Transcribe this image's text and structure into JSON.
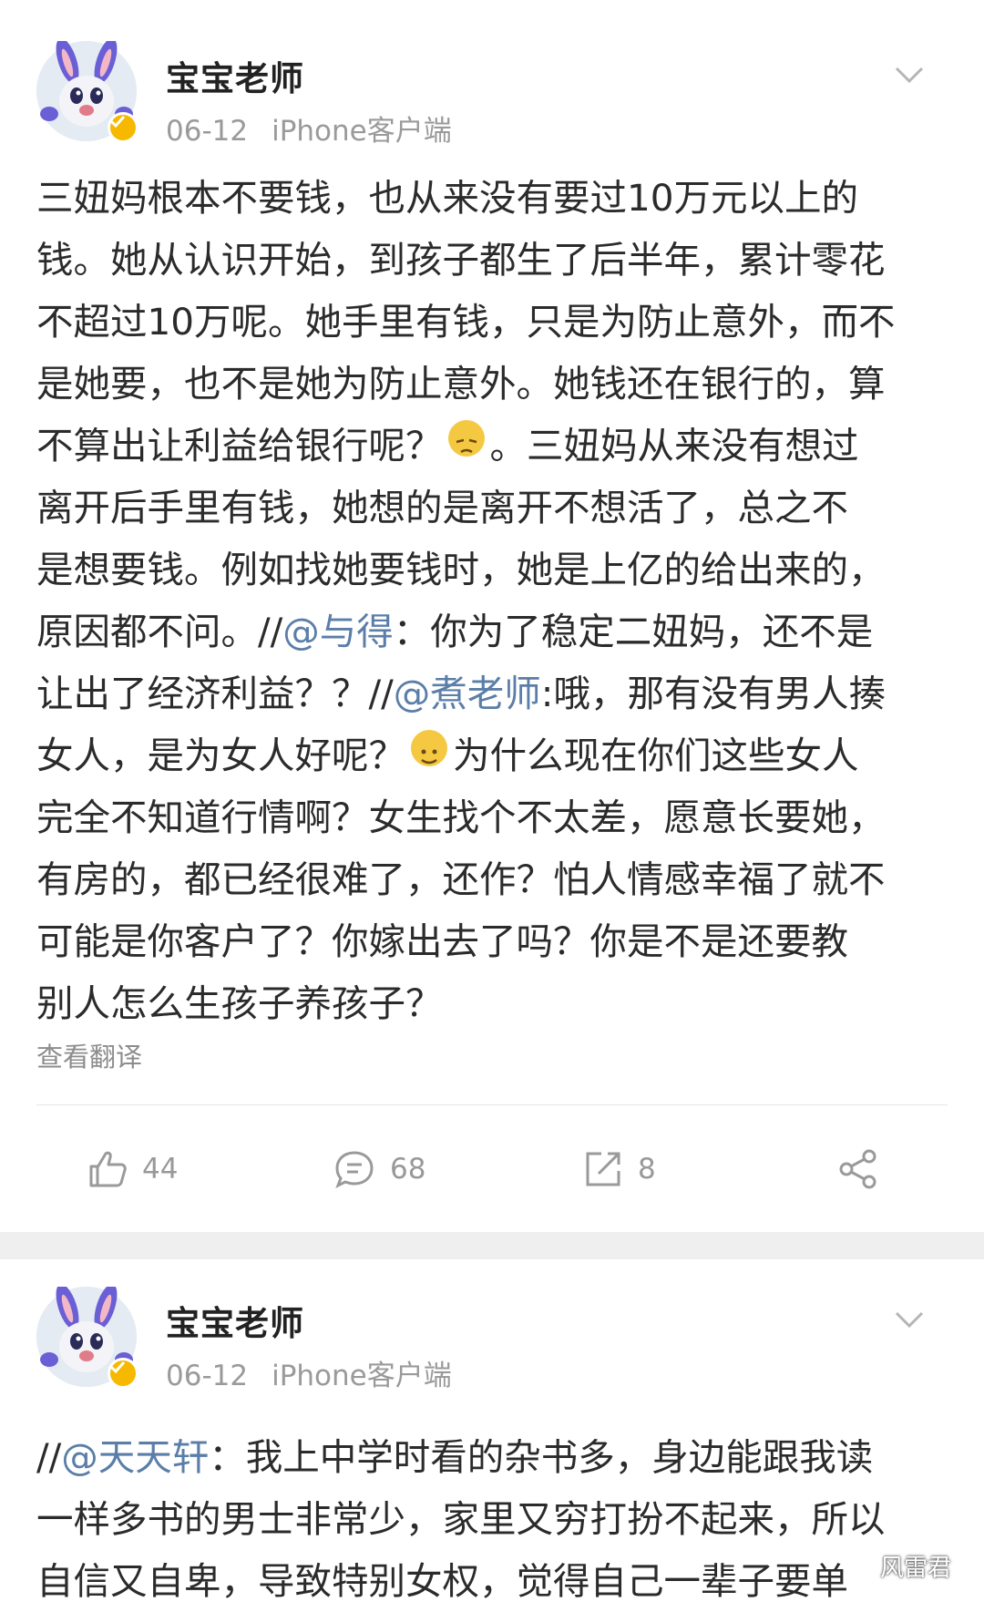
{
  "posts": [
    {
      "username": "宝宝老师",
      "date": "06-12",
      "client": "iPhone客户端",
      "lines": [
        [
          {
            "t": "三妞妈根本不要钱，也从来没有要过10万元以上的"
          }
        ],
        [
          {
            "t": "钱。她从认识开始，到孩子都生了后半年，累计零花"
          }
        ],
        [
          {
            "t": "不超过10万呢。她手里有钱，只是为防止意外，而不"
          }
        ],
        [
          {
            "t": "是她要，也不是她为防止意外。她钱还在银行的，算"
          }
        ],
        [
          {
            "t": "不算出让利益给银行呢？"
          },
          {
            "emoji": "dizzy-emoji"
          },
          {
            "t": "。三妞妈从来没有想过"
          }
        ],
        [
          {
            "t": "离开后手里有钱，她想的是离开不想活了，总之不"
          }
        ],
        [
          {
            "t": "是想要钱。例如找她要钱时，她是上亿的给出来的，"
          }
        ],
        [
          {
            "t": "原因都不问。//"
          },
          {
            "m": "@与得"
          },
          {
            "t": "：你为了稳定二妞妈，还不是"
          }
        ],
        [
          {
            "t": "让出了经济利益？？//"
          },
          {
            "m": "@煮老师"
          },
          {
            "t": ":哦，那有没有男人揍"
          }
        ],
        [
          {
            "t": "女人，是为女人好呢？"
          },
          {
            "emoji": "smile-emoji"
          },
          {
            "t": "为什么现在你们这些女人"
          }
        ],
        [
          {
            "t": "完全不知道行情啊？女生找个不太差，愿意长要她，"
          }
        ],
        [
          {
            "t": "有房的，都已经很难了，还作？怕人情感幸福了就不"
          }
        ],
        [
          {
            "t": "可能是你客户了？你嫁出去了吗？你是不是还要教"
          }
        ],
        [
          {
            "t": "别人怎么生孩子养孩子？"
          }
        ]
      ],
      "translate": "查看翻译",
      "likes": "44",
      "comments": "68",
      "reposts": "8"
    },
    {
      "username": "宝宝老师",
      "date": "06-12",
      "client": "iPhone客户端",
      "lines": [
        [
          {
            "t": "//"
          },
          {
            "m": "@天天轩"
          },
          {
            "t": "：我上中学时看的杂书多，身边能跟我读"
          }
        ],
        [
          {
            "t": "一样多书的男士非常少，家里又穷打扮不起来，所以"
          }
        ],
        [
          {
            "t": "自信又自卑，导致特别女权，觉得自己一辈子要单"
          }
        ]
      ]
    }
  ],
  "watermark": "风雷君",
  "colors": {
    "mention": "#5b7ea8",
    "meta": "#9a9a9a",
    "separator": "#efefef",
    "verified": "#f6b900"
  }
}
